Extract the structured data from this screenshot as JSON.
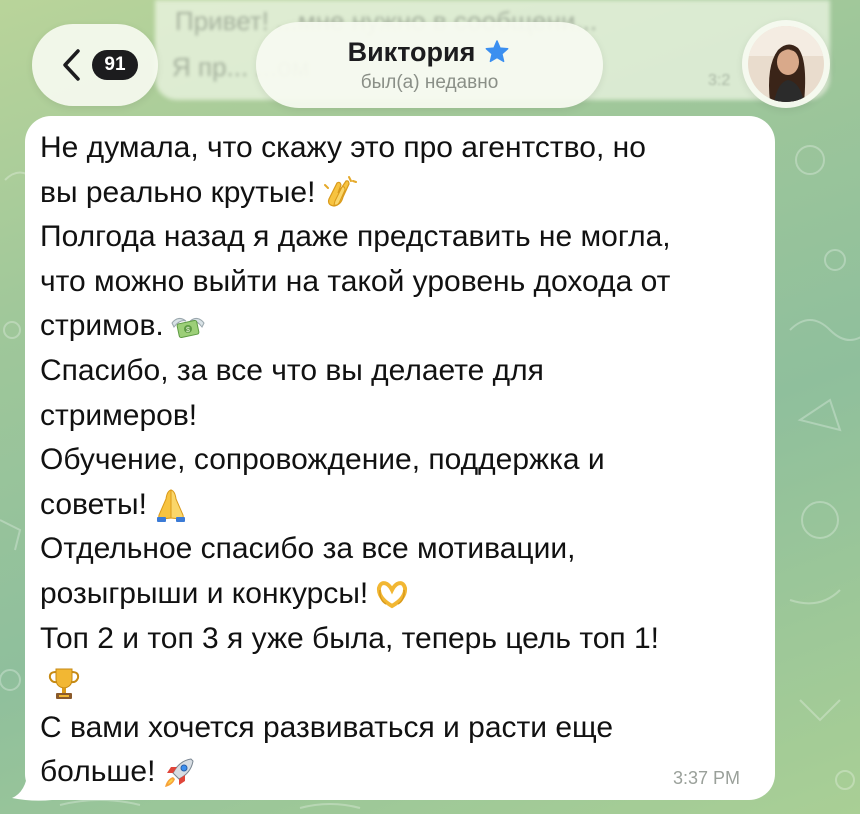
{
  "header": {
    "back_icon": "chevron-left-icon",
    "unread_count": "91",
    "contact_name": "Виктория",
    "premium_icon": "star-icon",
    "status": "был(а) недавно",
    "avatar_icon": "avatar-photo"
  },
  "background_message": {
    "line1": "Привет! ...мне нужно в сообщени...",
    "line2": "Я пр...    ...ом",
    "time": "3:2"
  },
  "message": {
    "lines": [
      {
        "text": "Не думала, что скажу это про агентство, но",
        "emoji": ""
      },
      {
        "text": "вы реально крутые!",
        "emoji": "clapping-hands-icon"
      },
      {
        "text": "Полгода назад я даже представить не могла,",
        "emoji": ""
      },
      {
        "text": "что можно выйти на такой уровень дохода от",
        "emoji": ""
      },
      {
        "text": "стримов.",
        "emoji": "money-with-wings-icon"
      },
      {
        "text": "Спасибо, за все что вы делаете для",
        "emoji": ""
      },
      {
        "text": "стримеров!",
        "emoji": ""
      },
      {
        "text": "Обучение, сопровождение, поддержка и",
        "emoji": ""
      },
      {
        "text": "советы!",
        "emoji": "folded-hands-icon"
      },
      {
        "text": "Отдельное спасибо за все мотивации,",
        "emoji": ""
      },
      {
        "text": "розыгрыши и конкурсы!",
        "emoji": "heart-hands-icon"
      },
      {
        "text": "Топ 2 и топ 3 я уже была, теперь цель топ 1!",
        "emoji": ""
      },
      {
        "text": "",
        "emoji": "trophy-icon"
      },
      {
        "text": "С вами хочется развиваться и расти еще",
        "emoji": ""
      },
      {
        "text": "больше!",
        "emoji": "rocket-icon"
      }
    ],
    "time": "3:37 PM"
  },
  "colors": {
    "bubble": "#ffffff",
    "badge": "#1c1c1e",
    "star": "#3b8ff0",
    "wallpaper": "#9fc79a"
  }
}
